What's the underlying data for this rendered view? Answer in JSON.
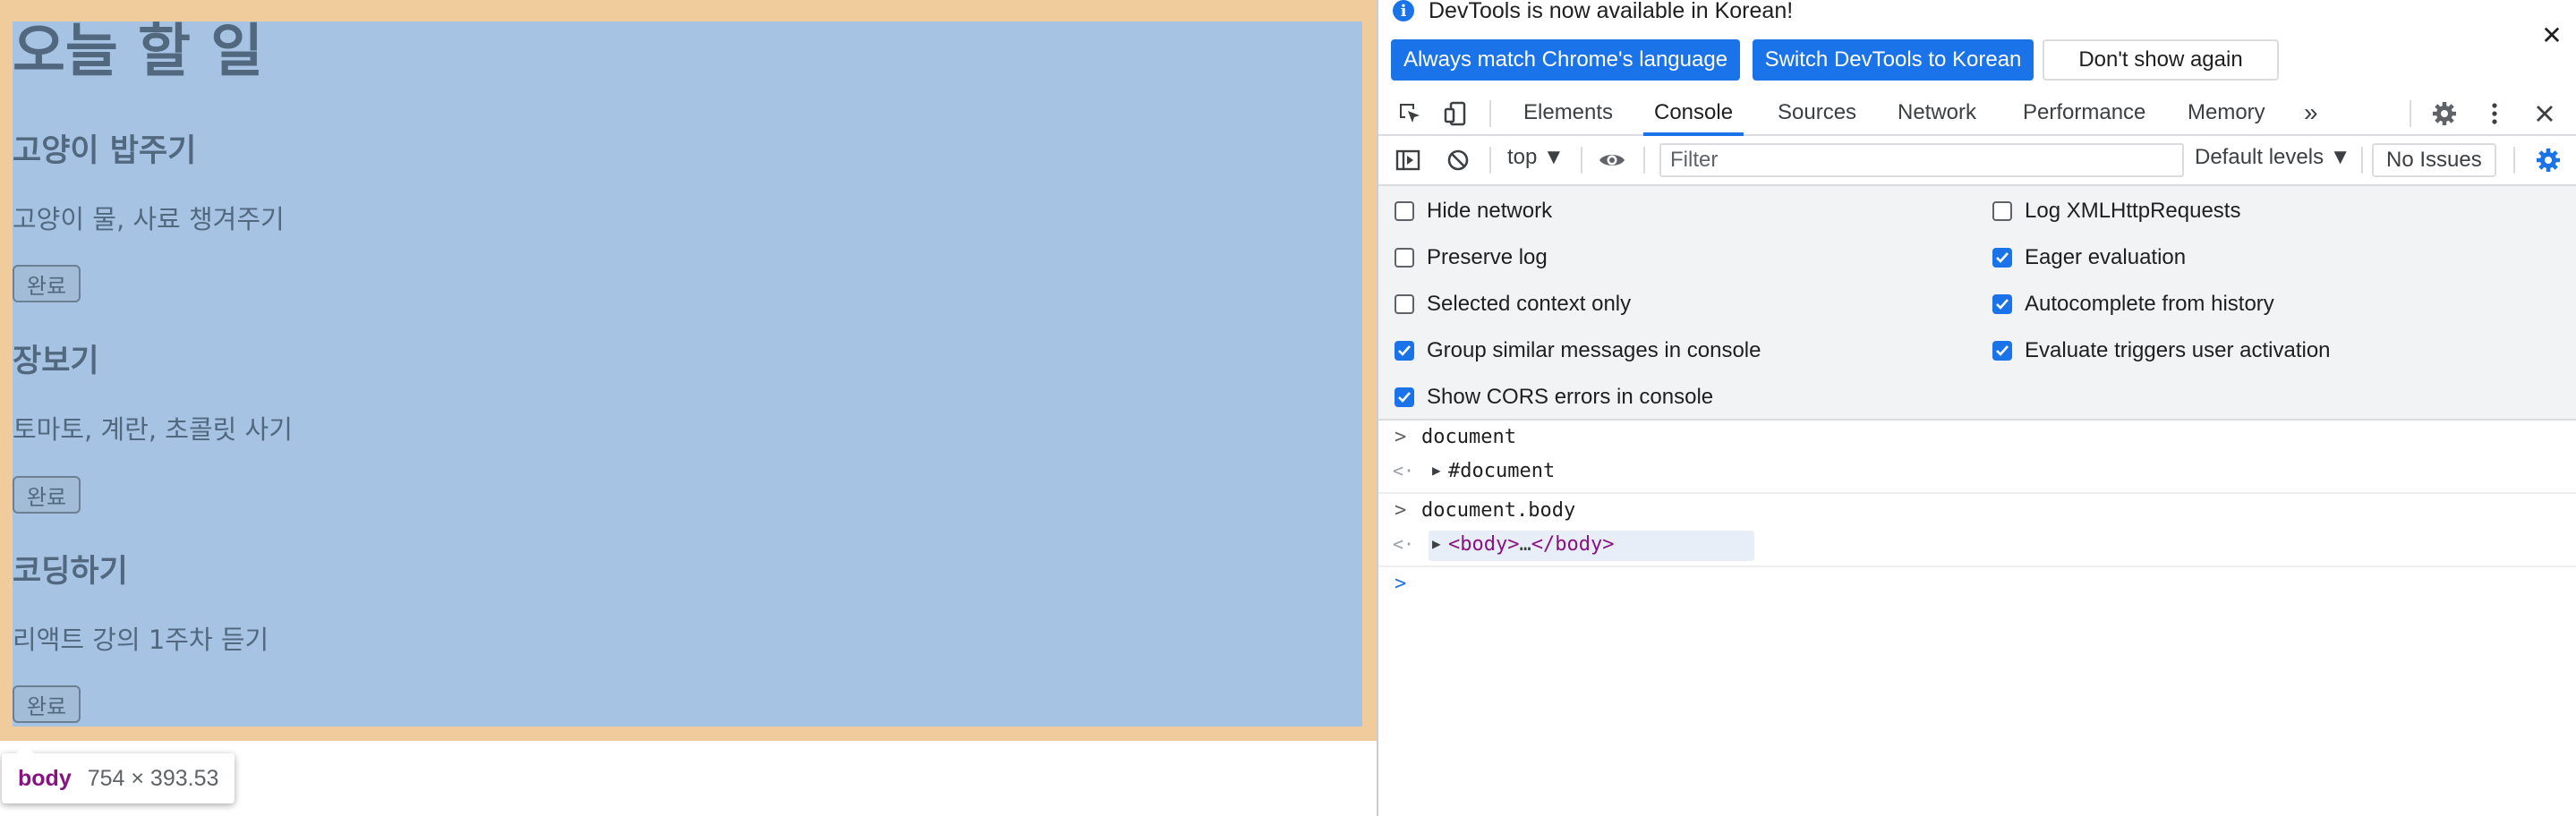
{
  "page": {
    "title": "오늘 할 일",
    "todos": [
      {
        "title": "고양이 밥주기",
        "description": "고양이 물, 사료 챙겨주기",
        "button": "완료"
      },
      {
        "title": "장보기",
        "description": "토마토, 계란, 초콜릿 사기",
        "button": "완료"
      },
      {
        "title": "코딩하기",
        "description": "리액트 강의 1주차 듣기",
        "button": "완료"
      }
    ],
    "tooltip": {
      "tag": "body",
      "size": "754 × 393.53"
    }
  },
  "devtools": {
    "infobar": {
      "message": "DevTools is now available in Korean!",
      "buttons": [
        "Always match Chrome's language",
        "Switch DevTools to Korean",
        "Don't show again"
      ]
    },
    "tabs": [
      "Elements",
      "Console",
      "Sources",
      "Network",
      "Performance",
      "Memory"
    ],
    "active_tab": "Console",
    "more_tabs_glyph": "»",
    "toolbar": {
      "context": "top ▼",
      "filter_placeholder": "Filter",
      "levels": "Default levels ▼",
      "issues": "No Issues"
    },
    "settings": {
      "left": [
        {
          "label": "Hide network",
          "checked": false
        },
        {
          "label": "Preserve log",
          "checked": false
        },
        {
          "label": "Selected context only",
          "checked": false
        },
        {
          "label": "Group similar messages in console",
          "checked": true
        },
        {
          "label": "Show CORS errors in console",
          "checked": true
        }
      ],
      "right": [
        {
          "label": "Log XMLHttpRequests",
          "checked": false
        },
        {
          "label": "Eager evaluation",
          "checked": true
        },
        {
          "label": "Autocomplete from history",
          "checked": true
        },
        {
          "label": "Evaluate triggers user activation",
          "checked": true
        }
      ]
    },
    "console": [
      {
        "input": "document",
        "result": "#document"
      },
      {
        "input": "document.body",
        "result_open": "<body>",
        "result_ellipsis": "…",
        "result_close": "</body>"
      }
    ],
    "accent": "#1a73e8"
  }
}
